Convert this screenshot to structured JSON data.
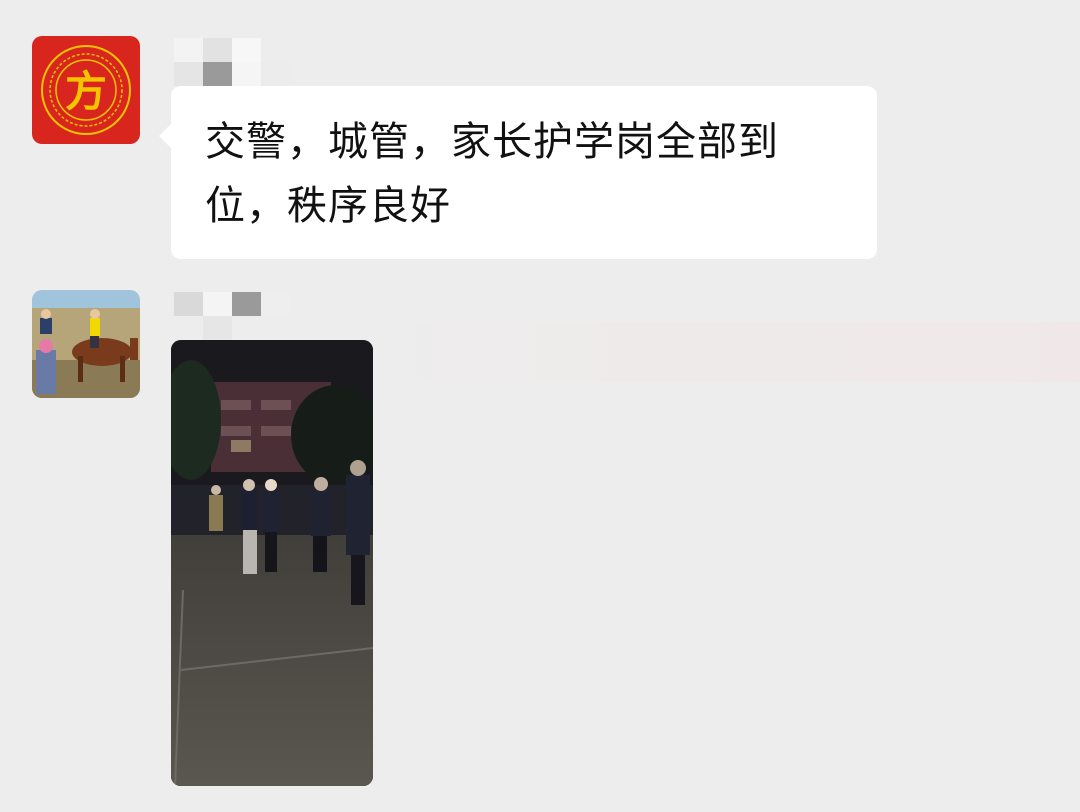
{
  "chat": {
    "messages": [
      {
        "sender_name": "",
        "avatar": {
          "icon": "red-seal-logo-icon",
          "glyph": "方",
          "colors": {
            "bg": "#d8261e",
            "glyph": "#f5c400"
          }
        },
        "type": "text",
        "text": "交警，城管，家长护学岗全部到位，秩序良好"
      },
      {
        "sender_name": "",
        "avatar": {
          "icon": "horse-riding-photo-icon"
        },
        "type": "image",
        "image": {
          "description_icon": "night-schoolyard-photo"
        }
      }
    ]
  },
  "colors": {
    "background": "#ededed",
    "bubble": "#ffffff",
    "text": "#111111"
  }
}
